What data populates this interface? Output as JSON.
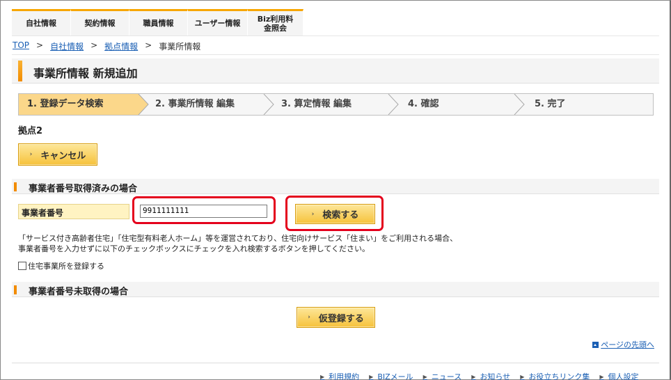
{
  "topnav": {
    "tabs": [
      "自社情報",
      "契約情報",
      "職員情報",
      "ユーザー情報",
      "Biz利用料金照会"
    ]
  },
  "breadcrumb": {
    "top": "TOP",
    "company": "自社情報",
    "branch": "拠点情報",
    "current": "事業所情報",
    "sep": ">"
  },
  "page": {
    "title": "事業所情報 新規追加"
  },
  "steps": [
    {
      "label": "1. 登録データ検索",
      "active": true
    },
    {
      "label": "2. 事業所情報 編集",
      "active": false
    },
    {
      "label": "3. 算定情報 編集",
      "active": false
    },
    {
      "label": "4. 確認",
      "active": false
    },
    {
      "label": "5. 完了",
      "active": false
    }
  ],
  "kyoten": "拠点2",
  "buttons": {
    "cancel": "キャンセル",
    "search": "検索する",
    "prereg": "仮登録する"
  },
  "section_registered": {
    "title": "事業者番号取得済みの場合",
    "field_label": "事業者番号",
    "field_value": "9911111111",
    "desc_line1": "「サービス付き高齢者住宅」「住宅型有料老人ホーム」等を運営されており、住宅向けサービス「住まい」をご利用される場合、",
    "desc_line2": "事業者番号を入力せずに以下のチェックボックスにチェックを入れ検索するボタンを押してください。",
    "checkbox_label": "住宅事業所を登録する"
  },
  "section_unregistered": {
    "title": "事業者番号未取得の場合"
  },
  "page_top": "ページの先頭へ",
  "footer": {
    "links": [
      "利用規約",
      "BIZメール",
      "ニュース",
      "お知らせ",
      "お役立ちリンク集",
      "個人設定"
    ]
  },
  "colors": {
    "accent": "#f28c00",
    "highlight": "#e4001c",
    "link": "#1a5fb4"
  }
}
